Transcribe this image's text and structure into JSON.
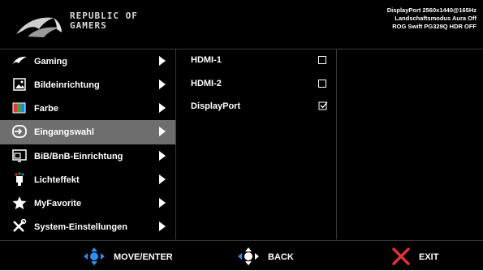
{
  "brand": {
    "line1": "REPUBLIC OF",
    "line2": "GAMERS"
  },
  "status": {
    "line1": "DisplayPort 2560x1440@165Hz",
    "line2": "Landschaftsmodus Aura Off",
    "line3": "ROG Swift PG329Q HDR OFF"
  },
  "menu": {
    "items": [
      {
        "label": "Gaming",
        "icon": "rog-eye-icon",
        "active": false
      },
      {
        "label": "Bildeinrichtung",
        "icon": "image-icon",
        "active": false
      },
      {
        "label": "Farbe",
        "icon": "color-icon",
        "active": false
      },
      {
        "label": "Eingangswahl",
        "icon": "input-icon",
        "active": true
      },
      {
        "label": "BiB/BnB-Einrichtung",
        "icon": "pip-icon",
        "active": false
      },
      {
        "label": "Lichteffekt",
        "icon": "light-effect-icon",
        "active": false
      },
      {
        "label": "MyFavorite",
        "icon": "star-icon",
        "active": false
      },
      {
        "label": "System-Einstellungen",
        "icon": "wrench-icon",
        "active": false
      }
    ]
  },
  "submenu": {
    "items": [
      {
        "label": "HDMI-1",
        "checked": false
      },
      {
        "label": "HDMI-2",
        "checked": false
      },
      {
        "label": "DisplayPort",
        "checked": true
      }
    ]
  },
  "footer": {
    "move_label": "MOVE/ENTER",
    "back_label": "BACK",
    "exit_label": "EXIT"
  },
  "colors": {
    "accent_blue": "#2f8ff0",
    "exit_red": "#e0303a",
    "active_bg": "#6e6e6e"
  }
}
